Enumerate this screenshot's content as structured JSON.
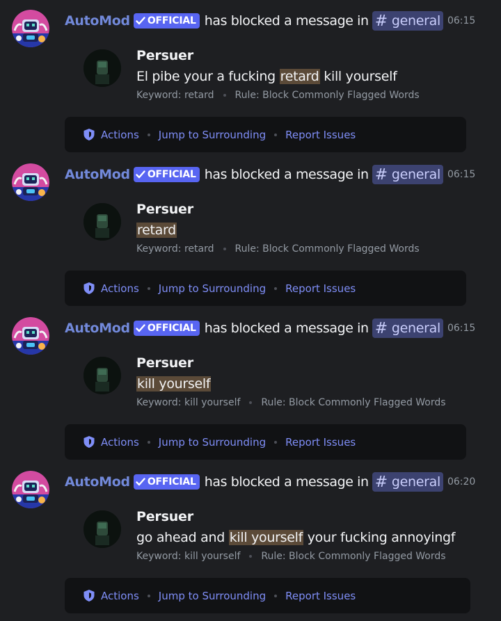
{
  "messages": [
    {
      "bot_name": "AutoMod",
      "badge": "OFFICIAL",
      "action_text": "has blocked a message in",
      "channel": "general",
      "timestamp": "06:15",
      "user": "Persuer",
      "content_parts": [
        {
          "text": "El pibe your a fucking ",
          "flagged": false
        },
        {
          "text": "retard",
          "flagged": true
        },
        {
          "text": " kill yourself",
          "flagged": false
        }
      ],
      "keyword": "Keyword: retard",
      "rule": "Rule: Block Commonly Flagged Words",
      "actions": [
        "Actions",
        "Jump to Surrounding",
        "Report Issues"
      ]
    },
    {
      "bot_name": "AutoMod",
      "badge": "OFFICIAL",
      "action_text": "has blocked a message in",
      "channel": "general",
      "timestamp": "06:15",
      "user": "Persuer",
      "content_parts": [
        {
          "text": "retard",
          "flagged": true
        }
      ],
      "keyword": "Keyword: retard",
      "rule": "Rule: Block Commonly Flagged Words",
      "actions": [
        "Actions",
        "Jump to Surrounding",
        "Report Issues"
      ]
    },
    {
      "bot_name": "AutoMod",
      "badge": "OFFICIAL",
      "action_text": "has blocked a message in",
      "channel": "general",
      "timestamp": "06:15",
      "user": "Persuer",
      "content_parts": [
        {
          "text": "kill yourself",
          "flagged": true
        }
      ],
      "keyword": "Keyword: kill yourself",
      "rule": "Rule: Block Commonly Flagged Words",
      "actions": [
        "Actions",
        "Jump to Surrounding",
        "Report Issues"
      ]
    },
    {
      "bot_name": "AutoMod",
      "badge": "OFFICIAL",
      "action_text": "has blocked a message in",
      "channel": "general",
      "timestamp": "06:20",
      "user": "Persuer",
      "content_parts": [
        {
          "text": "go ahead and ",
          "flagged": false
        },
        {
          "text": "kill yourself",
          "flagged": true
        },
        {
          "text": " your fucking annoyingf",
          "flagged": false
        }
      ],
      "keyword": "Keyword: kill yourself",
      "rule": "Rule: Block Commonly Flagged Words",
      "actions": [
        "Actions",
        "Jump to Surrounding",
        "Report Issues"
      ]
    }
  ],
  "colors": {
    "background": "#1e1f22",
    "bot_name": "#7289da",
    "badge": "#5865f2",
    "channel_pill": "#3c4270",
    "link": "#7f8ef7",
    "flag_highlight": "#5b4a38"
  },
  "icons": {
    "badge_check": "checkmark-icon",
    "actions": "shield-icon",
    "avatar": "automod-bot-avatar"
  }
}
